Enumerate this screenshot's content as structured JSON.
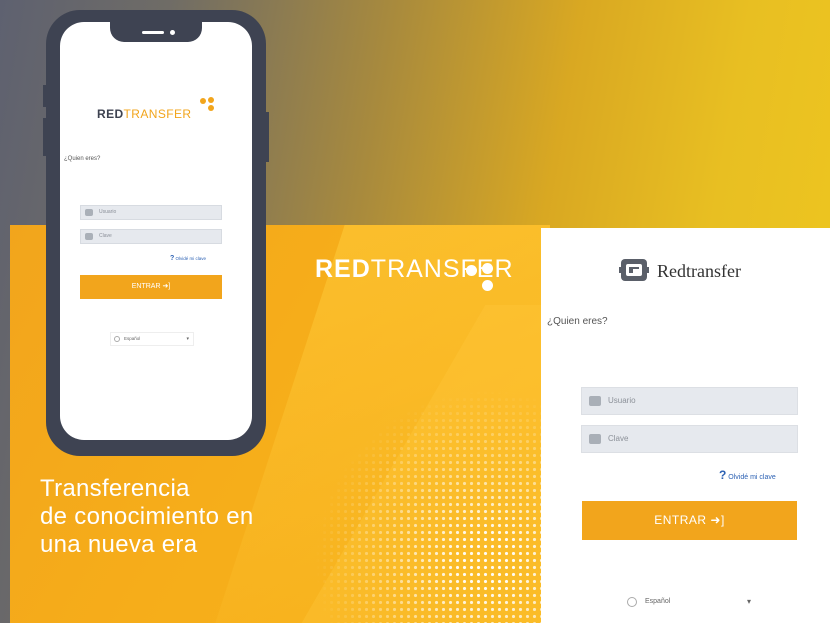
{
  "brand": {
    "bold": "RED",
    "light": "TRANSFER"
  },
  "tagline": {
    "line1": "Transferencia",
    "line2": "de conocimiento en",
    "line3": "una nueva era"
  },
  "phone_login": {
    "question": "¿Quien eres?",
    "username_placeholder": "Usuario",
    "password_placeholder": "Clave",
    "forgot_icon": "?",
    "forgot_label": "Olvidé mi clave",
    "submit_label": "ENTRAR ➜]",
    "language": "Español",
    "language_caret": "▾"
  },
  "card_login": {
    "title": "Redtransfer",
    "question": "¿Quien eres?",
    "username_placeholder": "Usuario",
    "password_placeholder": "Clave",
    "forgot_icon": "?",
    "forgot_label": "Olvidé mi clave",
    "submit_label": "ENTRAR ➜]",
    "language": "Español",
    "language_caret": "▾"
  },
  "colors": {
    "accent": "#f2a51c",
    "dark": "#3e4352",
    "link": "#2d62b4"
  },
  "icons": [
    "user-icon",
    "lock-icon",
    "help-icon",
    "sign-in-icon",
    "globe-icon",
    "chevron-down-icon",
    "redtransfer-logo-icon"
  ]
}
